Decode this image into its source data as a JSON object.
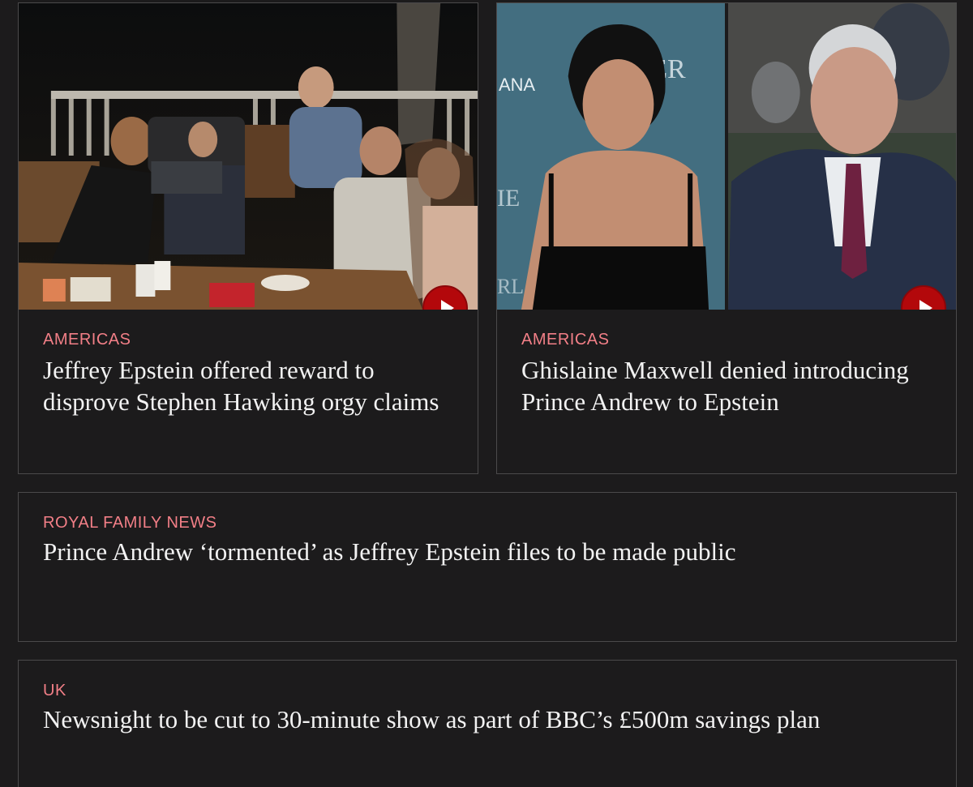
{
  "articles": [
    {
      "category": "AMERICAS",
      "headline": "Jeffrey Epstein offered reward to disprove Stephen Hawking orgy claims",
      "has_video": true,
      "image": "group-photo-at-dinner-table"
    },
    {
      "category": "AMERICAS",
      "headline": "Ghislaine Maxwell denied introducing Prince Andrew to Epstein",
      "has_video": true,
      "image": "split-portrait-woman-and-man"
    },
    {
      "category": "ROYAL FAMILY NEWS",
      "headline": "Prince Andrew ‘tormented’ as Jeffrey Epstein files to be made public",
      "has_video": false
    },
    {
      "category": "UK",
      "headline": "Newsnight to be cut to 30-minute show as part of BBC’s £500m savings plan",
      "has_video": false
    }
  ],
  "photo_text": {
    "backdrop_top": "ANA",
    "backdrop_corner": "ER",
    "backdrop_mid": "IE",
    "backdrop_low": "RL"
  },
  "colors": {
    "background": "#1c1b1c",
    "card_border": "#4b4a4b",
    "kicker": "#f27f87",
    "headline": "#f2f2f2",
    "play_button": "#b3080b"
  },
  "icons": {
    "play": "play-triangle-icon"
  }
}
